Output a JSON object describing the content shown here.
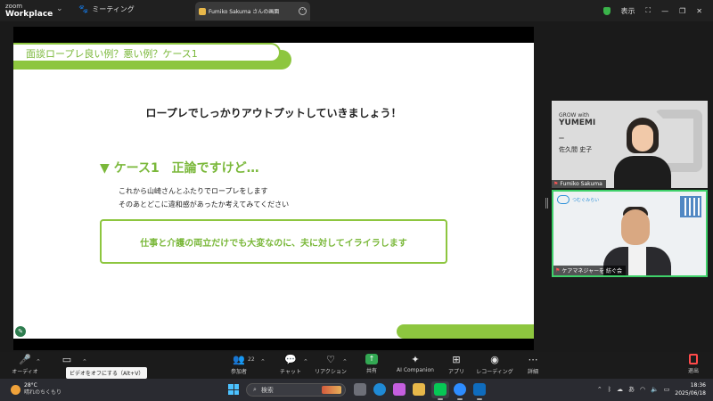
{
  "app": {
    "logo_line1": "zoom",
    "logo_line2": "Workplace",
    "meeting_tab": "ミーティング",
    "share_tab": "Fumiko Sakuma さんの画面",
    "view_label": "表示",
    "accent_color": "#8dc63f"
  },
  "slide": {
    "header": "面談ロープレ良い例？悪い例？ケース1",
    "headline": "ロープレでしっかりアウトプットしていきましょう！",
    "case_title": "▼ ケース1　正論ですけど…",
    "line1": "これから山崎さんとふたりでロープレをします",
    "line2": "そのあとどこに違和感があったか考えてみてください",
    "quote": "仕事と介護の両立だけでも大変なのに、夫に対してイライラします"
  },
  "video": {
    "tile1": {
      "brand_small": "GROW with",
      "brand_big": "YUMEMI",
      "caption_name": "佐久間 史子",
      "name": "Fumiko Sakuma"
    },
    "tile2": {
      "org": "つむぐみらい",
      "name": "ケアマネジャーを 紡ぐ会"
    }
  },
  "toolbar": {
    "audio": "オーディオ",
    "video_tooltip": "ビデオをオフにする（Alt+V）",
    "participants": "参加者",
    "participants_count": "22",
    "chat": "チャット",
    "reactions": "リアクション",
    "share": "共有",
    "ai": "AI Companion",
    "apps": "アプリ",
    "recording": "レコーディング",
    "details": "詳細",
    "leave": "退出"
  },
  "taskbar": {
    "temperature": "28°C",
    "condition": "晴れのちくもり",
    "search_placeholder": "検索",
    "ime": "あ",
    "time": "18:36",
    "date": "2025/06/18"
  }
}
